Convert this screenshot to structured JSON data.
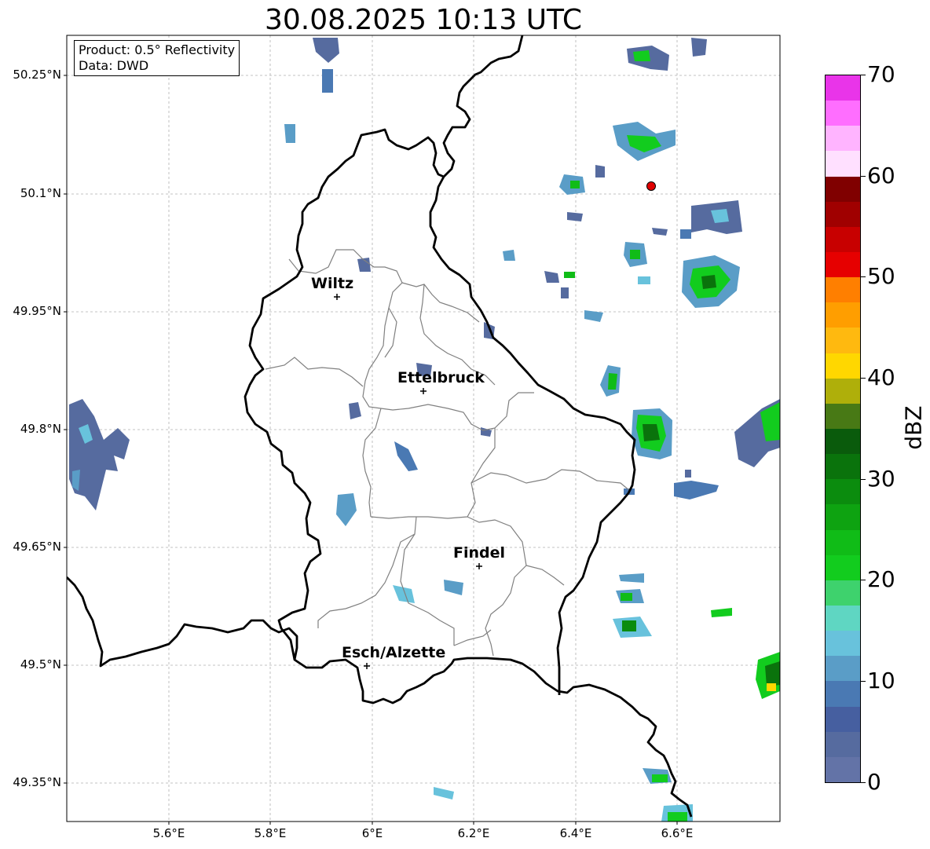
{
  "title": "30.08.2025 10:13 UTC",
  "info_box": {
    "product": "Product: 0.5° Reflectivity",
    "source": "Data: DWD"
  },
  "latitude_labels": [
    "50.25°N",
    "50.1°N",
    "49.95°N",
    "49.8°N",
    "49.65°N",
    "49.5°N",
    "49.35°N"
  ],
  "longitude_labels": [
    "5.6°E",
    "5.8°E",
    "6°E",
    "6.2°E",
    "6.4°E",
    "6.6°E"
  ],
  "cities": [
    {
      "name": "Wiltz"
    },
    {
      "name": "Ettelbruck"
    },
    {
      "name": "Findel"
    },
    {
      "name": "Esch/Alzette"
    }
  ],
  "colorbar": {
    "label": "dBZ",
    "min": 0,
    "max": 70,
    "tick_labels": [
      "0",
      "10",
      "20",
      "30",
      "40",
      "50",
      "60",
      "70"
    ],
    "colors": [
      "#6373a7",
      "#566b9f",
      "#465fa0",
      "#4a79b3",
      "#5a9dc7",
      "#68c2dc",
      "#5fd6c2",
      "#3ed26d",
      "#12cc1e",
      "#10bc17",
      "#0ea311",
      "#0b8c0e",
      "#0a730c",
      "#0a5b0c",
      "#487915",
      "#afaf0a",
      "#ffd700",
      "#ffb90f",
      "#ff9e00",
      "#ff7f00",
      "#e60000",
      "#c80000",
      "#a00000",
      "#800000",
      "#ffe0ff",
      "#ffb4ff",
      "#ff6eff",
      "#e934e9"
    ]
  },
  "radar_site_marker": "red-circle"
}
